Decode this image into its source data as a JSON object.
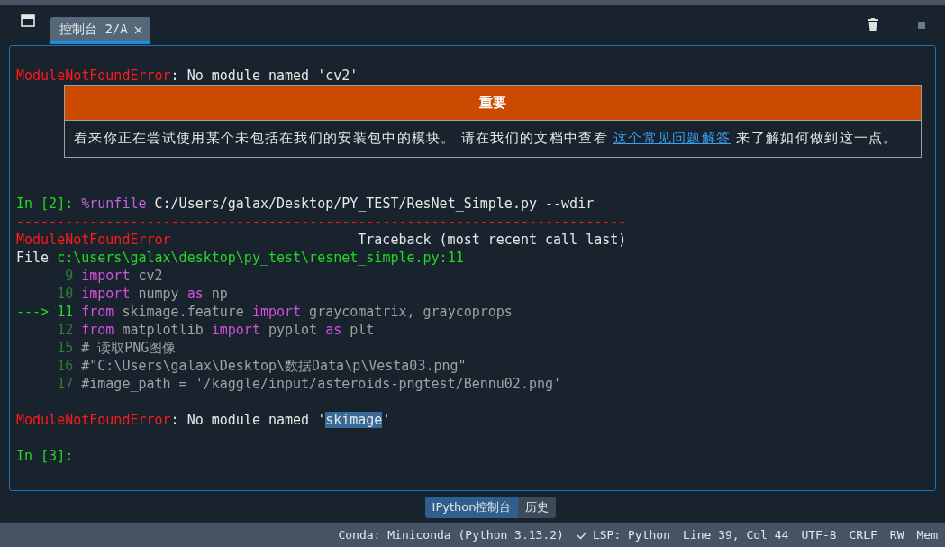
{
  "tabs": [
    {
      "label": "控制台 2/A",
      "close": "×",
      "selected": true
    }
  ],
  "console": [
    {
      "kind": "text",
      "segments": [
        {
          "kind": "error",
          "text": "ModuleNotFoundError"
        },
        {
          "kind": "plain",
          "text": ": No module named 'cv2'"
        }
      ]
    },
    {
      "kind": "notice",
      "title": "重要",
      "before": "看来你正在尝试使用某个未包括在我们的安装包中的模块。 请在我们的文档中查看 ",
      "link": "这个常见问题解答",
      "after": " 来了解如何做到这一点。"
    },
    {
      "kind": "text",
      "segments": [
        {
          "kind": "prompt",
          "text": "In [2]: "
        },
        {
          "kind": "magic",
          "text": "%runfile"
        },
        {
          "kind": "plain",
          "text": " C:/Users/galax/Desktop/PY_TEST/ResNet_Simple.py --wdir"
        }
      ]
    },
    {
      "kind": "separator",
      "text": "---------------------------------------------------------------------------"
    },
    {
      "kind": "traceback",
      "error": "ModuleNotFoundError",
      "note": "Traceback (most recent call last)"
    },
    {
      "kind": "text",
      "segments": [
        {
          "kind": "plain",
          "text": "File "
        },
        {
          "kind": "path",
          "text": "c:\\users\\galax\\desktop\\py_test\\resnet_simple.py:11"
        }
      ]
    },
    {
      "kind": "code",
      "number": "9",
      "segments": [
        {
          "kind": "kw",
          "text": "import"
        },
        {
          "kind": "name",
          "text": " cv2"
        }
      ]
    },
    {
      "kind": "code",
      "number": "10",
      "segments": [
        {
          "kind": "kw",
          "text": "import"
        },
        {
          "kind": "name",
          "text": " numpy "
        },
        {
          "kind": "kw",
          "text": "as"
        },
        {
          "kind": "name",
          "text": " np"
        }
      ]
    },
    {
      "kind": "code",
      "arrow": "--->",
      "number": "11",
      "segments": [
        {
          "kind": "kw",
          "text": "from"
        },
        {
          "kind": "name",
          "text": " skimage.feature "
        },
        {
          "kind": "kw",
          "text": "import"
        },
        {
          "kind": "name",
          "text": " graycomatrix, graycoprops"
        }
      ]
    },
    {
      "kind": "code",
      "number": "12",
      "segments": [
        {
          "kind": "kw",
          "text": "from"
        },
        {
          "kind": "name",
          "text": " matplotlib "
        },
        {
          "kind": "kw",
          "text": "import"
        },
        {
          "kind": "name",
          "text": " pyplot "
        },
        {
          "kind": "kw",
          "text": "as"
        },
        {
          "kind": "name",
          "text": " plt"
        }
      ]
    },
    {
      "kind": "code",
      "number": "15",
      "segments": [
        {
          "kind": "comment",
          "text": "# 读取PNG图像"
        }
      ]
    },
    {
      "kind": "code",
      "number": "16",
      "segments": [
        {
          "kind": "comment",
          "text": "#\"C:\\Users\\galax\\Desktop\\数据Data\\p\\Vesta03.png\""
        }
      ]
    },
    {
      "kind": "code",
      "number": "17",
      "segments": [
        {
          "kind": "comment",
          "text": "#image_path = '/kaggle/input/asteroids-pngtest/Bennu02.png'"
        }
      ]
    },
    {
      "kind": "text",
      "segments": [
        {
          "kind": "error",
          "text": "ModuleNotFoundError"
        },
        {
          "kind": "plain",
          "text": ": No module named '"
        },
        {
          "kind": "selection",
          "text": "skimage"
        },
        {
          "kind": "plain",
          "text": "'"
        }
      ]
    },
    {
      "kind": "text",
      "segments": [
        {
          "kind": "prompt",
          "text": "In [3]:"
        }
      ]
    }
  ],
  "bottom_tabs": [
    {
      "label": "IPython控制台",
      "selected": true
    },
    {
      "label": "历史",
      "selected": false
    }
  ],
  "status_bar": [
    {
      "text": "Conda: Miniconda (Python 3.13.2)"
    },
    {
      "text": "LSP: Python",
      "check": true
    },
    {
      "text": "Line 39, Col 44"
    },
    {
      "text": "UTF-8"
    },
    {
      "text": "CRLF"
    },
    {
      "text": "RW"
    },
    {
      "text": "Mem"
    }
  ]
}
